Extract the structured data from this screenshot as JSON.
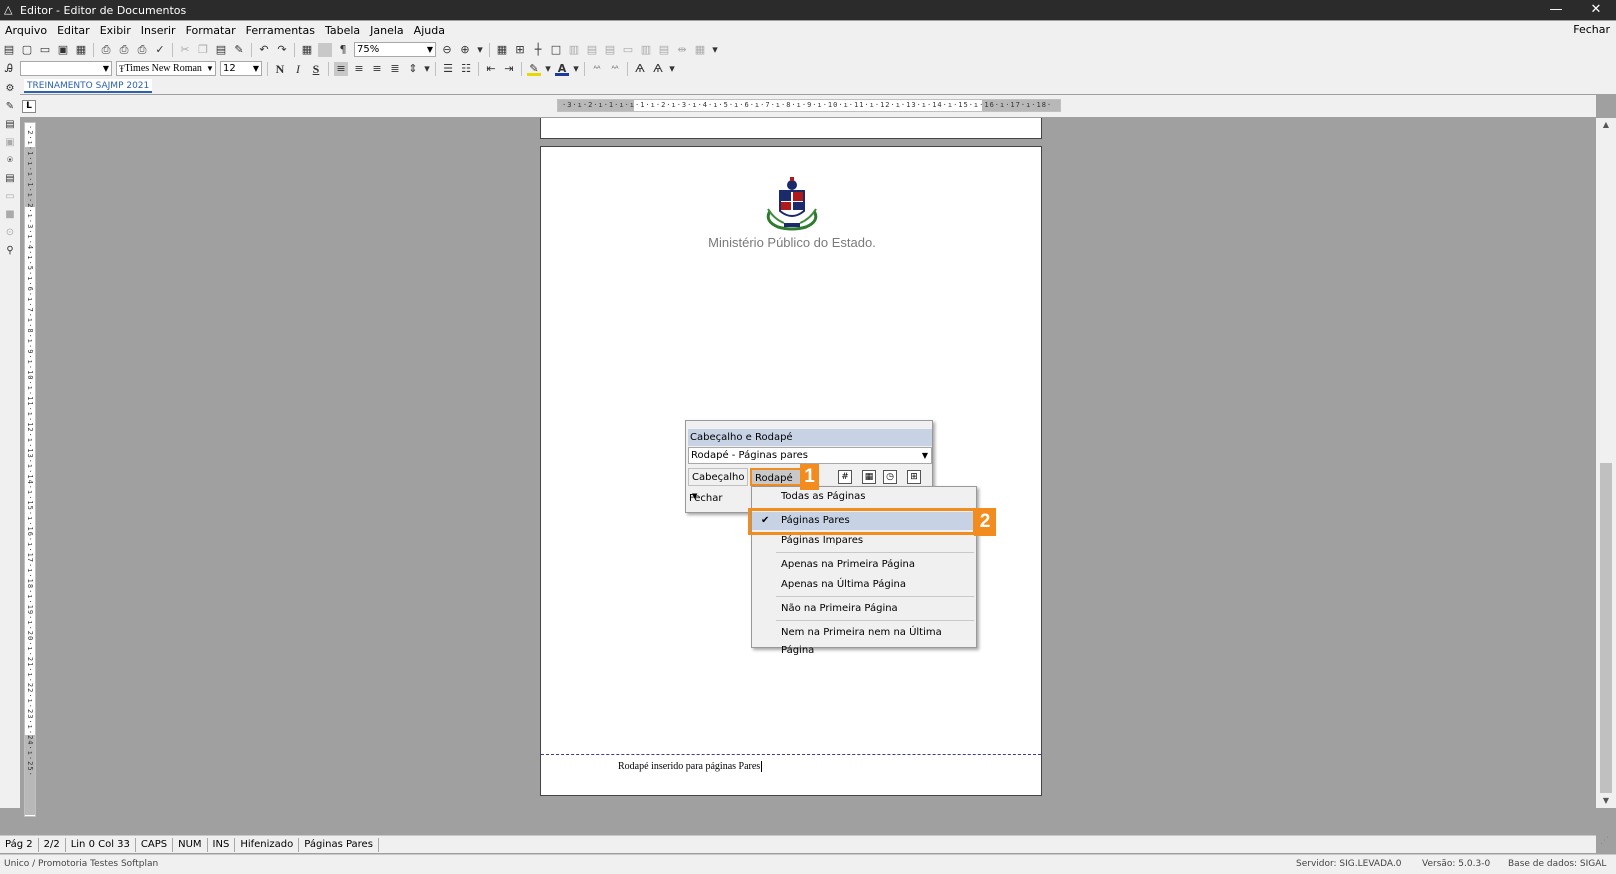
{
  "window": {
    "title": "Editor - Editor de Documentos",
    "minimize": "—",
    "close": "✕"
  },
  "menu": {
    "items": [
      "Arquivo",
      "Editar",
      "Exibir",
      "Inserir",
      "Formatar",
      "Ferramentas",
      "Tabela",
      "Janela",
      "Ajuda"
    ],
    "right": "Fechar"
  },
  "toolbar": {
    "zoom": "75%",
    "font_name": "Times New Roman",
    "font_size": "12",
    "style_value": "",
    "bold": "N",
    "italic": "I",
    "underline": "S"
  },
  "tab": {
    "label": "TREINAMENTO SAJMP 2021"
  },
  "ruler": {
    "corner": "L",
    "h_ticks": "·3·ı·2·ı·1·ı·ı·1·ı·2·ı·3·ı·4·ı·5·ı·6·ı·7·ı·8·ı·9·ı·10·ı·11·ı·12·ı·13·ı·14·ı·15·ı·16·ı·17·ı·18·",
    "v_ticks": "·2·ı·1·ı·ı·1·ı·2·ı·3·ı·4·ı·5·ı·6·ı·7·ı·8·ı·9·ı·10·ı·11·ı·12·ı·13·ı·14·ı·15·ı·16·ı·17·ı·18·ı·19·ı·20·ı·21·ı·22·ı·23·ı·24·ı·25·"
  },
  "document": {
    "org_name": "Ministério Público do Estado.",
    "footer_text": "Rodapé inserido para páginas Pares"
  },
  "hf_panel": {
    "title": "Cabeçalho e Rodapé",
    "selected": "Rodapé -  Páginas pares",
    "header_button": "Cabeçalho",
    "footer_button": "Rodapé",
    "close": "Fechar"
  },
  "callouts": {
    "one": "1",
    "two": "2"
  },
  "dropdown": {
    "items": [
      {
        "label": "Todas as Páginas",
        "checked": false
      },
      {
        "label": "Páginas Pares",
        "checked": true
      },
      {
        "label": "Páginas Ímpares",
        "checked": false
      },
      {
        "label": "Apenas na Primeira Página",
        "checked": false
      },
      {
        "label": "Apenas na Última Página",
        "checked": false
      },
      {
        "label": "Não na Primeira Página",
        "checked": false
      },
      {
        "label": "Nem na Primeira nem na Última Página",
        "checked": false
      }
    ]
  },
  "status": {
    "page": "Pág 2",
    "pages": "2/2",
    "position": "Lin 0  Col 33",
    "caps": "CAPS",
    "num": "NUM",
    "ins": "INS",
    "hyphen": "Hifenizado",
    "footer_mode": "Páginas Pares"
  },
  "footer": {
    "org": "Unico / Promotoria Testes Softplan",
    "server": "Servidor: SIG.LEVADA.0",
    "version": "Versão: 5.0.3-0",
    "database": "Base de dados: SIGAL"
  },
  "colors": {
    "accent": "#f28c1e",
    "highlight": "#c7d3e5",
    "title_bar": "#2b2b2b",
    "tab": "#2a62b0"
  }
}
